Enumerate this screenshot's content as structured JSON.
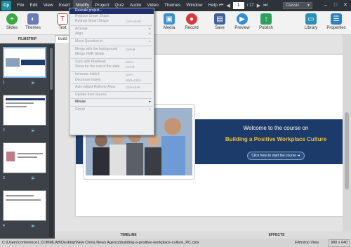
{
  "app": {
    "logo": "Cp"
  },
  "menubar": {
    "items": [
      "File",
      "Edit",
      "View",
      "Insert",
      "Modify",
      "Project",
      "Quiz",
      "Audio",
      "Video",
      "Themes",
      "Window",
      "Help"
    ],
    "active": "Modify",
    "page_current": "1",
    "page_total": "/ 17",
    "theme": "Classic"
  },
  "toolbar": {
    "slides": "Slides",
    "themes": "Themes",
    "text": "Text",
    "media": "Media",
    "record": "Record",
    "save": "Save",
    "preview": "Preview",
    "publish": "Publish",
    "library": "Library",
    "properties": "Properties"
  },
  "filmstrip": {
    "title": "FILMSTRIP",
    "slides": [
      "1",
      "2",
      "3",
      "4"
    ]
  },
  "document": {
    "tab": "build"
  },
  "slide": {
    "welcome": "Welcome to the course on",
    "course": "Building a Positive Workplace Culture",
    "start": "Click here to start the course"
  },
  "bottom": {
    "timeline": "TIMELINE",
    "effects": "EFFECTS"
  },
  "status": {
    "path": "C:\\Users\\conference1.COMMLAB\\Desktop\\New China News Agency\\building-a-positive-workplace-culture_PC.cptx",
    "view": "Filmstrip View",
    "resolution": "980 x 640"
  },
  "modify_menu": {
    "items": [
      {
        "label": "Rescale project...",
        "shortcut": "",
        "submenu": false,
        "state": "highlight"
      },
      {
        "label": "Replace Smart Shape",
        "shortcut": "",
        "submenu": false,
        "state": "disabled"
      },
      {
        "label": "Redraw Smart Shape",
        "shortcut": "Ctrl+Alt+W",
        "submenu": false,
        "state": "disabled"
      },
      {
        "sep": true
      },
      {
        "label": "Arrange",
        "shortcut": "",
        "submenu": true,
        "state": "disabled"
      },
      {
        "label": "Align",
        "shortcut": "",
        "submenu": true,
        "state": "disabled"
      },
      {
        "sep": true
      },
      {
        "label": "Move Question to",
        "shortcut": "",
        "submenu": true,
        "state": "disabled"
      },
      {
        "sep": true
      },
      {
        "label": "Merge with the background",
        "shortcut": "Ctrl+M",
        "submenu": false,
        "state": "disabled"
      },
      {
        "label": "Merge FMR Slides",
        "shortcut": "",
        "submenu": false,
        "state": "disabled"
      },
      {
        "sep": true
      },
      {
        "label": "Sync with Playhead",
        "shortcut": "Ctrl+L",
        "submenu": false,
        "state": "disabled"
      },
      {
        "label": "Show for the rest of the slide",
        "shortcut": "Ctrl+E",
        "submenu": false,
        "state": "disabled"
      },
      {
        "sep": true
      },
      {
        "label": "Increase Indent",
        "shortcut": "Ctrl+I",
        "submenu": false,
        "state": "disabled"
      },
      {
        "label": "Decrease Indent",
        "shortcut": "Shift+Ctrl+I",
        "submenu": false,
        "state": "disabled"
      },
      {
        "sep": true
      },
      {
        "label": "Auto-adjust Rollover Area",
        "shortcut": "Ctrl+Alt+R",
        "submenu": false,
        "state": "disabled"
      },
      {
        "sep": true
      },
      {
        "label": "Update from Source",
        "shortcut": "",
        "submenu": false,
        "state": "disabled"
      },
      {
        "sep": true
      },
      {
        "label": "Mouse",
        "shortcut": "",
        "submenu": true,
        "state": "enabled"
      },
      {
        "sep": true
      },
      {
        "label": "Group",
        "shortcut": "",
        "submenu": true,
        "state": "disabled"
      }
    ]
  },
  "colors": {
    "accent": "#1f2f6a",
    "slide_band": "#1c3a6a",
    "course_title": "#f2c230"
  }
}
